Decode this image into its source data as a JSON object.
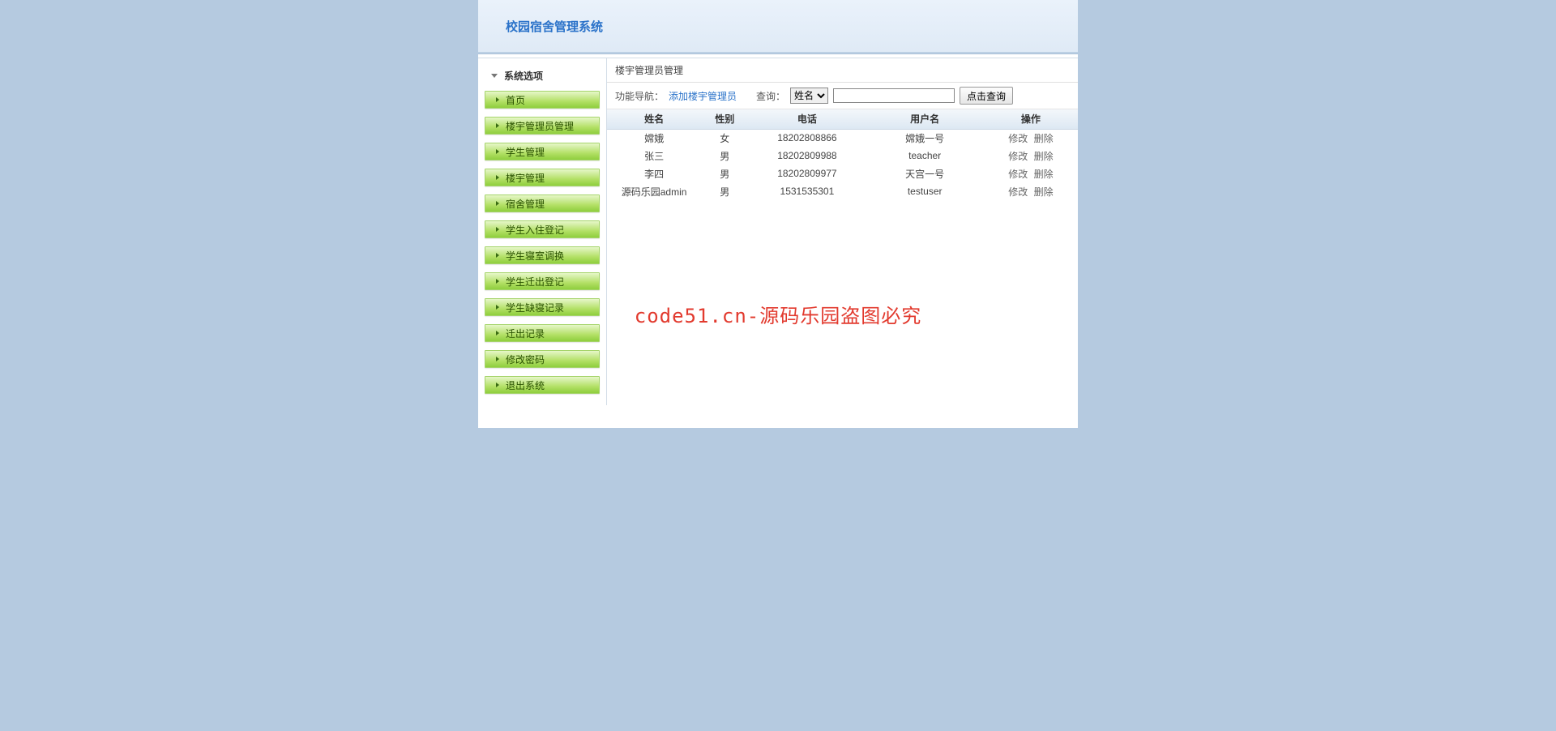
{
  "header": {
    "title": "校园宿舍管理系统"
  },
  "sidebar": {
    "title": "系统选项",
    "items": [
      {
        "label": "首页"
      },
      {
        "label": "楼宇管理员管理"
      },
      {
        "label": "学生管理"
      },
      {
        "label": "楼宇管理"
      },
      {
        "label": "宿舍管理"
      },
      {
        "label": "学生入住登记"
      },
      {
        "label": "学生寝室调换"
      },
      {
        "label": "学生迁出登记"
      },
      {
        "label": "学生缺寝记录"
      },
      {
        "label": "迁出记录"
      },
      {
        "label": "修改密码"
      },
      {
        "label": "退出系统"
      }
    ]
  },
  "content": {
    "title": "楼宇管理员管理",
    "nav_label": "功能导航：",
    "nav_link": "添加楼宇管理员",
    "query_label": "查询：",
    "select_options": [
      "姓名"
    ],
    "select_value": "姓名",
    "search_value": "",
    "search_button": "点击查询",
    "columns": [
      "姓名",
      "性别",
      "电话",
      "用户名",
      "操作"
    ],
    "op_edit": "修改",
    "op_delete": "删除",
    "rows": [
      {
        "name": "嫦娥",
        "gender": "女",
        "phone": "18202808866",
        "user": "嫦娥一号"
      },
      {
        "name": "张三",
        "gender": "男",
        "phone": "18202809988",
        "user": "teacher"
      },
      {
        "name": "李四",
        "gender": "男",
        "phone": "18202809977",
        "user": "天宫一号"
      },
      {
        "name": "源码乐园admin",
        "gender": "男",
        "phone": "1531535301",
        "user": "testuser"
      }
    ]
  },
  "watermark": "code51.cn-源码乐园盗图必究"
}
